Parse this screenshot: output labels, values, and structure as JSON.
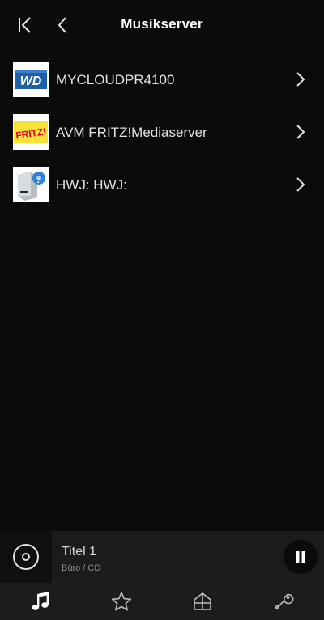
{
  "header": {
    "title": "Musikserver",
    "first_icon": "skip-to-start-icon",
    "back_icon": "chevron-left-icon"
  },
  "servers": [
    {
      "label": "MYCLOUDPR4100",
      "icon": "wd-logo-icon"
    },
    {
      "label": "AVM FRITZ!Mediaserver",
      "icon": "fritz-logo-icon"
    },
    {
      "label": "HWJ: HWJ:",
      "icon": "media-server-icon"
    }
  ],
  "player": {
    "title": "Titel 1",
    "subtitle": "Büro / CD",
    "disc_icon": "disc-icon",
    "pause_icon": "pause-icon"
  },
  "nav": [
    {
      "icon": "music-note-icon",
      "active": true
    },
    {
      "icon": "star-icon",
      "active": false
    },
    {
      "icon": "home-icon",
      "active": false
    },
    {
      "icon": "wrench-icon",
      "active": false
    }
  ],
  "colors": {
    "background": "#0b0b0b",
    "player_bar": "#1b1b1b",
    "nav_bar": "#1c1c1c",
    "text": "#e2e2e2",
    "active_nav": "#ffffff",
    "inactive_nav": "#bdbdbd",
    "fritz_red": "#e2001a",
    "wd_blue": "#1d5fa8"
  }
}
